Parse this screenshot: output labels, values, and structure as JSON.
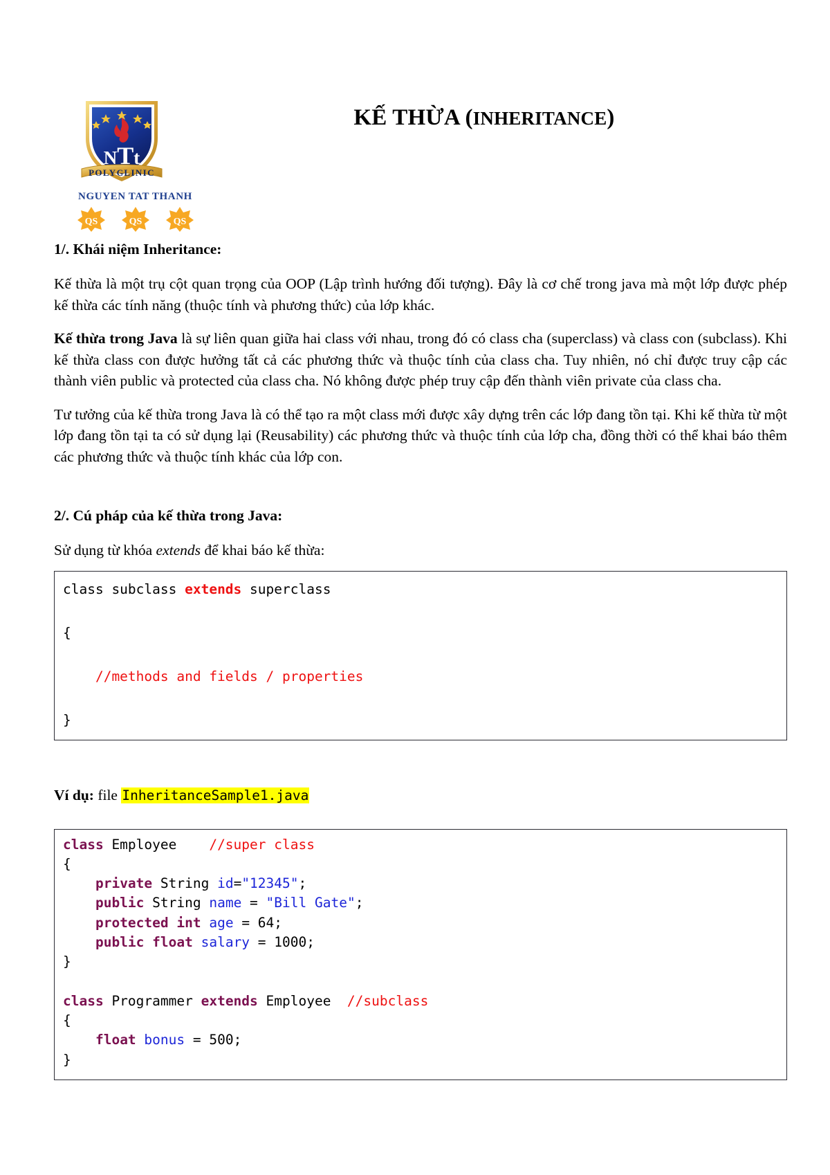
{
  "document": {
    "title": "KẾ THỪA (INHERITANCE)",
    "title_main": "KẾ THỪA (",
    "title_caps": "INHERITANCE",
    "title_close": ")"
  },
  "logo": {
    "monogram": "NTT",
    "ribbon_text": "POLYCLINIC",
    "org_name": "NGUYEN TAT THANH",
    "badge_label": "QS",
    "badge_count": 3,
    "colors": {
      "shield_blue": "#1a3a96",
      "shield_gold": "#e3b23c",
      "flame_red": "#d6282b",
      "text_blue": "#1f3f8f",
      "badge_gold": "#f5a623"
    }
  },
  "sections": [
    {
      "heading": "1/. Khái niệm Inheritance:",
      "paragraphs": [
        {
          "lead_bold": "",
          "text": "Kế thừa là một trụ cột quan trọng của OOP (Lập trình hướng đối tượng). Đây là cơ chế trong java mà một lớp được phép kế thừa các tính năng (thuộc tính và phương thức) của lớp khác."
        },
        {
          "lead_bold": "Kế thừa trong Java",
          "text": " là sự liên quan giữa hai class với nhau, trong đó có class cha (superclass) và class con (subclass). Khi kế thừa class con được hưởng tất cả các phương thức và thuộc tính của class cha. Tuy nhiên, nó chỉ được truy cập các thành viên public và protected của class cha. Nó không được phép truy cập đến thành viên private của class cha."
        },
        {
          "lead_bold": "",
          "text": "Tư tưởng của kế thừa trong Java là có thể tạo ra một class mới được xây dựng trên các lớp đang tồn tại. Khi kế thừa từ một lớp đang tồn tại ta có sử dụng lại (Reusability) các phương thức và thuộc tính của lớp cha, đồng thời có thể khai báo thêm các phương thức và thuộc tính khác của lớp con."
        }
      ]
    },
    {
      "heading": "2/. Cú pháp của kế thừa trong Java:",
      "intro_before": "Sử dụng từ khóa ",
      "intro_keyword": "extends",
      "intro_after": " để khai báo kế thừa:"
    }
  ],
  "syntax_code": {
    "lines": [
      [
        {
          "t": "class subclass ",
          "c": "plain"
        },
        {
          "t": "extends",
          "c": "kw-red"
        },
        {
          "t": " superclass",
          "c": "plain"
        }
      ],
      [],
      [
        {
          "t": "{",
          "c": "plain"
        }
      ],
      [],
      [
        {
          "t": "    //methods and fields / properties",
          "c": "cmt"
        }
      ],
      [],
      [
        {
          "t": "}",
          "c": "plain"
        }
      ]
    ]
  },
  "example": {
    "label": "Ví dụ:",
    "before_file": " file ",
    "file_name": "InheritanceSample1.java"
  },
  "example_code": {
    "lines": [
      [
        {
          "t": "class",
          "c": "kw"
        },
        {
          "t": " Employee    ",
          "c": "plain"
        },
        {
          "t": "//super class",
          "c": "cmt"
        }
      ],
      [
        {
          "t": "{",
          "c": "plain"
        }
      ],
      [
        {
          "t": "    ",
          "c": "plain"
        },
        {
          "t": "private",
          "c": "kw"
        },
        {
          "t": " String ",
          "c": "plain"
        },
        {
          "t": "id",
          "c": "var"
        },
        {
          "t": "=",
          "c": "plain"
        },
        {
          "t": "\"12345\"",
          "c": "str"
        },
        {
          "t": ";",
          "c": "plain"
        }
      ],
      [
        {
          "t": "    ",
          "c": "plain"
        },
        {
          "t": "public",
          "c": "kw"
        },
        {
          "t": " String ",
          "c": "plain"
        },
        {
          "t": "name",
          "c": "var"
        },
        {
          "t": " = ",
          "c": "plain"
        },
        {
          "t": "\"Bill Gate\"",
          "c": "str"
        },
        {
          "t": ";",
          "c": "plain"
        }
      ],
      [
        {
          "t": "    ",
          "c": "plain"
        },
        {
          "t": "protected int",
          "c": "kw"
        },
        {
          "t": " ",
          "c": "plain"
        },
        {
          "t": "age",
          "c": "var"
        },
        {
          "t": " = 64;",
          "c": "plain"
        }
      ],
      [
        {
          "t": "    ",
          "c": "plain"
        },
        {
          "t": "public float",
          "c": "kw"
        },
        {
          "t": " ",
          "c": "plain"
        },
        {
          "t": "salary",
          "c": "var"
        },
        {
          "t": " = 1000;",
          "c": "plain"
        }
      ],
      [
        {
          "t": "}",
          "c": "plain"
        }
      ],
      [],
      [
        {
          "t": "class",
          "c": "kw"
        },
        {
          "t": " Programmer ",
          "c": "plain"
        },
        {
          "t": "extends",
          "c": "kw"
        },
        {
          "t": " Employee  ",
          "c": "plain"
        },
        {
          "t": "//subclass",
          "c": "cmt"
        }
      ],
      [
        {
          "t": "{",
          "c": "plain"
        }
      ],
      [
        {
          "t": "    ",
          "c": "plain"
        },
        {
          "t": "float",
          "c": "kw"
        },
        {
          "t": " ",
          "c": "plain"
        },
        {
          "t": "bonus",
          "c": "var"
        },
        {
          "t": " = 500;",
          "c": "plain"
        }
      ],
      [
        {
          "t": "}",
          "c": "plain"
        }
      ]
    ]
  }
}
